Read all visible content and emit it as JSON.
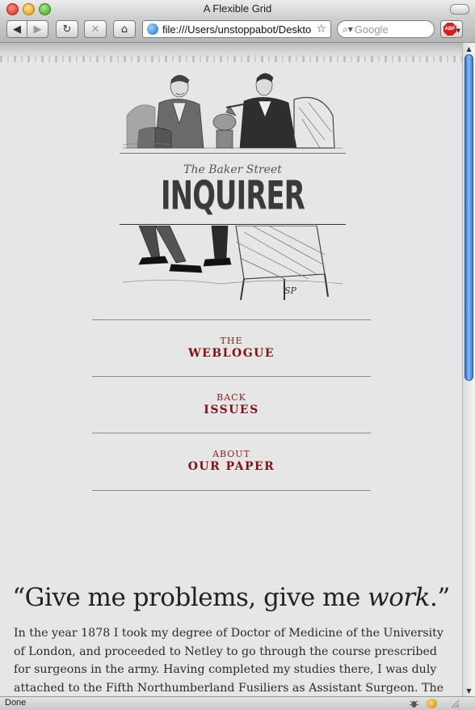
{
  "window": {
    "title": "A Flexible Grid"
  },
  "toolbar": {
    "url": "file:///Users/unstoppabot/Desktop",
    "search_placeholder": "Google",
    "abp_label": "ABP"
  },
  "masthead": {
    "tagline": "The Baker Street",
    "logo": "INQUIRER",
    "signature": "SP"
  },
  "nav": {
    "items": [
      {
        "small": "THE",
        "big": "WEBLOGUE"
      },
      {
        "small": "BACK",
        "big": "ISSUES"
      },
      {
        "small": "ABOUT",
        "big": "OUR PAPER"
      }
    ]
  },
  "article": {
    "quote_open": "“Give me problems, give me ",
    "quote_em": "work",
    "quote_close": ".”",
    "body": "In the year 1878 I took my degree of Doctor of Medicine of the University of London, and proceeded to Netley to go through the course prescribed for surgeons in the army. Having completed my studies there, I was duly attached to the Fifth Northumberland Fusiliers as Assistant Surgeon. The regiment was"
  },
  "status": {
    "text": "Done"
  }
}
